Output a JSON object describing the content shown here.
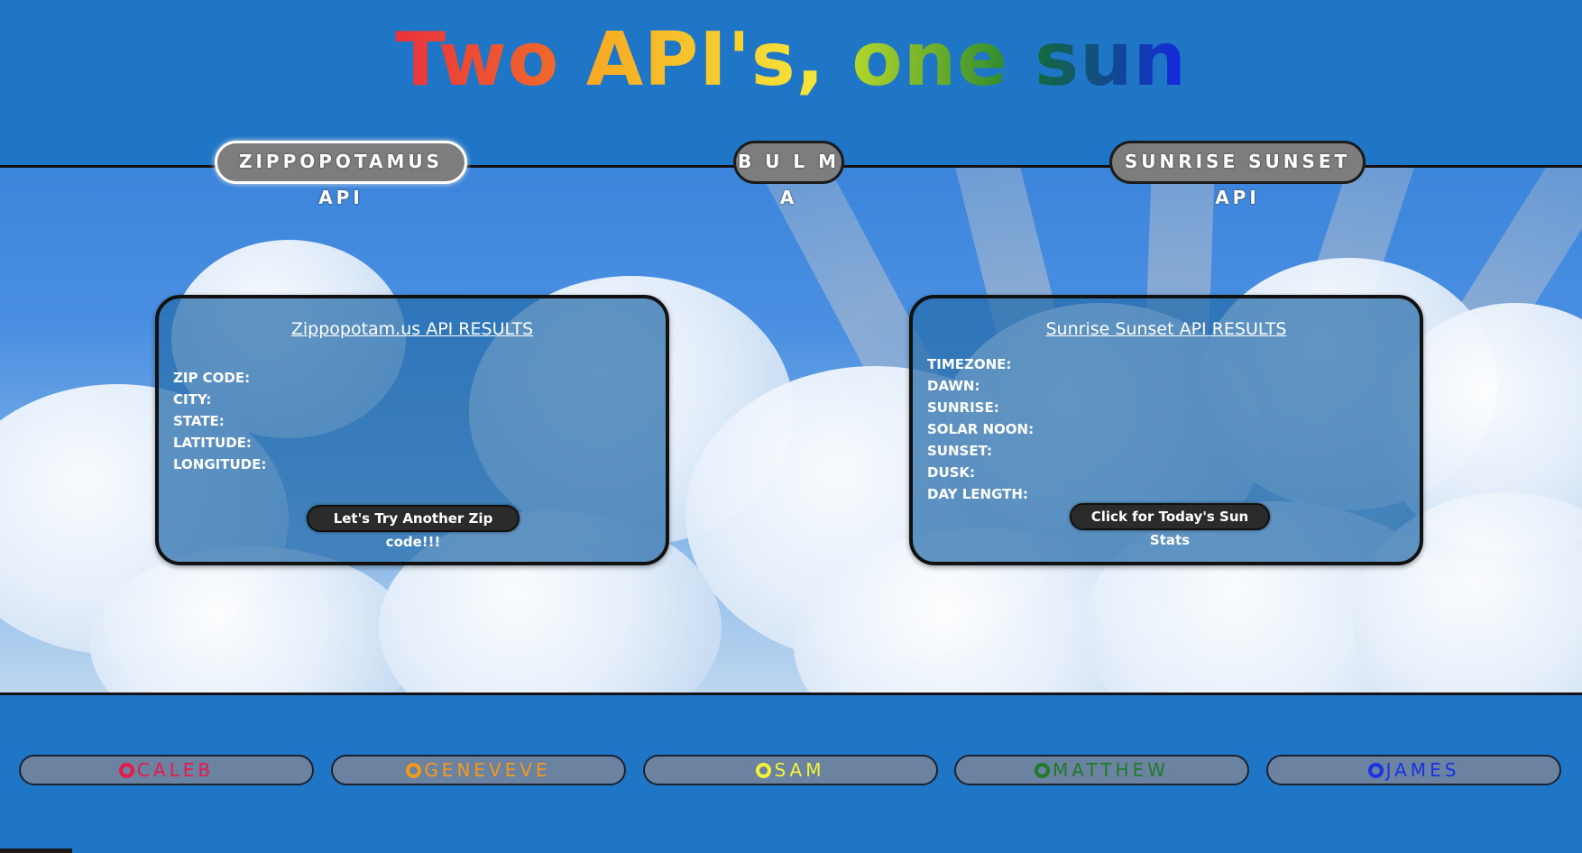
{
  "header": {
    "title_words": [
      "Two",
      "API's,",
      "one",
      "sun"
    ],
    "title_colors": [
      "#e63838",
      "#f6c223",
      "#3d9b2c",
      "#1e2fd0"
    ]
  },
  "nav": {
    "items": [
      {
        "label": "ZIPPOPOTAMUS  API",
        "active": true
      },
      {
        "label": "B U L M A",
        "active": false
      },
      {
        "label": "SUNRISE SUNSET API",
        "active": false
      }
    ]
  },
  "zip_card": {
    "title": "Zippopotam.us API RESULTS",
    "fields": [
      "ZIP CODE:",
      "CITY:",
      "STATE:",
      "LATITUDE:",
      "LONGITUDE:"
    ],
    "button_label": "Let's Try Another Zip code!!!"
  },
  "sun_card": {
    "title": "Sunrise Sunset API RESULTS",
    "fields": [
      "TIMEZONE:",
      "DAWN:",
      "SUNRISE:",
      "SOLAR NOON:",
      "SUNSET:",
      "DUSK:",
      "DAY LENGTH:"
    ],
    "button_label": "Click for Today's Sun Stats"
  },
  "footer": {
    "members": [
      {
        "name": "CALEB",
        "color": "#e8194a",
        "icon": "github-icon"
      },
      {
        "name": "GENEVEVE",
        "color": "#f39a1c",
        "icon": "github-icon"
      },
      {
        "name": "SAM",
        "color": "#f6f23a",
        "icon": "github-icon"
      },
      {
        "name": "MATTHEW",
        "color": "#1f7a2a",
        "icon": "github-icon"
      },
      {
        "name": "JAMES",
        "color": "#1932e6",
        "icon": "github-icon"
      }
    ]
  }
}
